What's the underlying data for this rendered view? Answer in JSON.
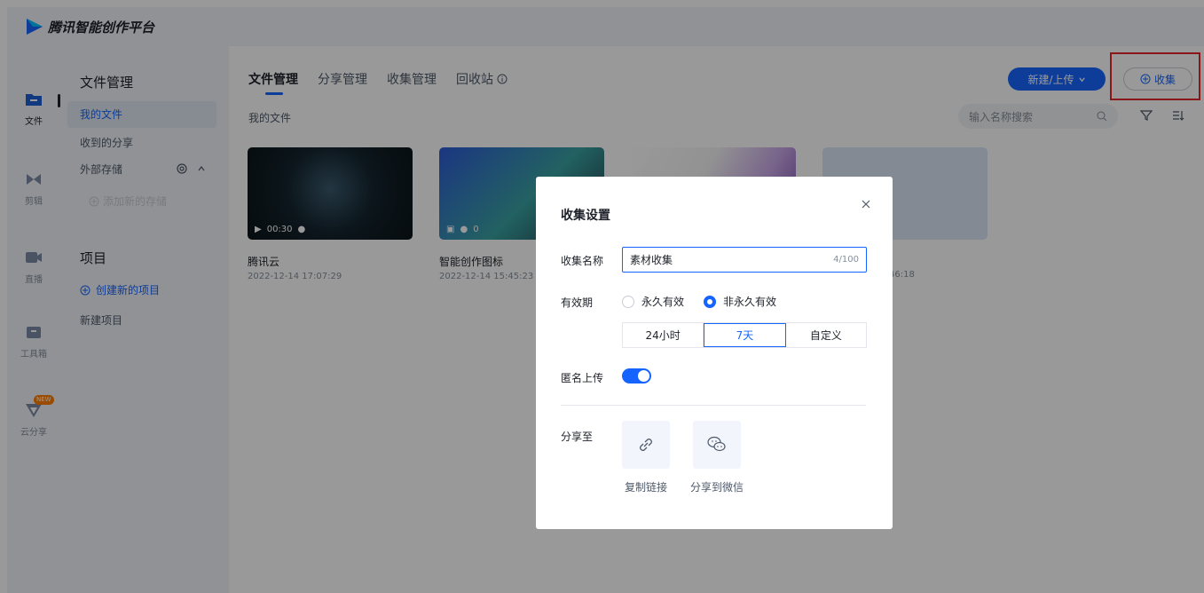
{
  "app": {
    "title": "腾讯智能创作平台"
  },
  "rail": [
    {
      "label": "文件",
      "icon": "folder-icon"
    },
    {
      "label": "剪辑",
      "icon": "clip-icon"
    },
    {
      "label": "直播",
      "icon": "live-icon"
    },
    {
      "label": "工具箱",
      "icon": "toolbox-icon"
    },
    {
      "label": "云分享",
      "icon": "cloud-share-icon",
      "badge": "NEW"
    }
  ],
  "sidebar": {
    "files_heading": "文件管理",
    "my_files": "我的文件",
    "received": "收到的分享",
    "external": "外部存储",
    "add_storage": "添加新的存储",
    "projects_heading": "项目",
    "create_project": "创建新的项目",
    "new_project": "新建项目"
  },
  "tabs": [
    "文件管理",
    "分享管理",
    "收集管理",
    "回收站"
  ],
  "breadcrumb": "我的文件",
  "toolbar": {
    "new_upload": "新建/上传",
    "collect": "收集",
    "search_placeholder": "输入名称搜索"
  },
  "cards": [
    {
      "title": "腾讯云",
      "time": "2022-12-14 17:07:29",
      "duration": "00:30"
    },
    {
      "title": "智能创作图标",
      "time": "2022-12-14 15:45:23",
      "count": "0"
    },
    {
      "title": "",
      "time": ""
    },
    {
      "title": "",
      "time_suffix": "46:18"
    }
  ],
  "modal": {
    "title": "收集设置",
    "name_label": "收集名称",
    "name_value": "素材收集",
    "name_count": "4/100",
    "validity_label": "有效期",
    "permanent": "永久有效",
    "non_permanent": "非永久有效",
    "durations": [
      "24小时",
      "7天",
      "自定义"
    ],
    "selected_duration": "7天",
    "anonymous_label": "匿名上传",
    "anonymous_on": true,
    "share_label": "分享至",
    "copy_link": "复制链接",
    "share_wechat": "分享到微信"
  },
  "colors": {
    "accent": "#1664ff",
    "highlight": "#e8262a"
  }
}
